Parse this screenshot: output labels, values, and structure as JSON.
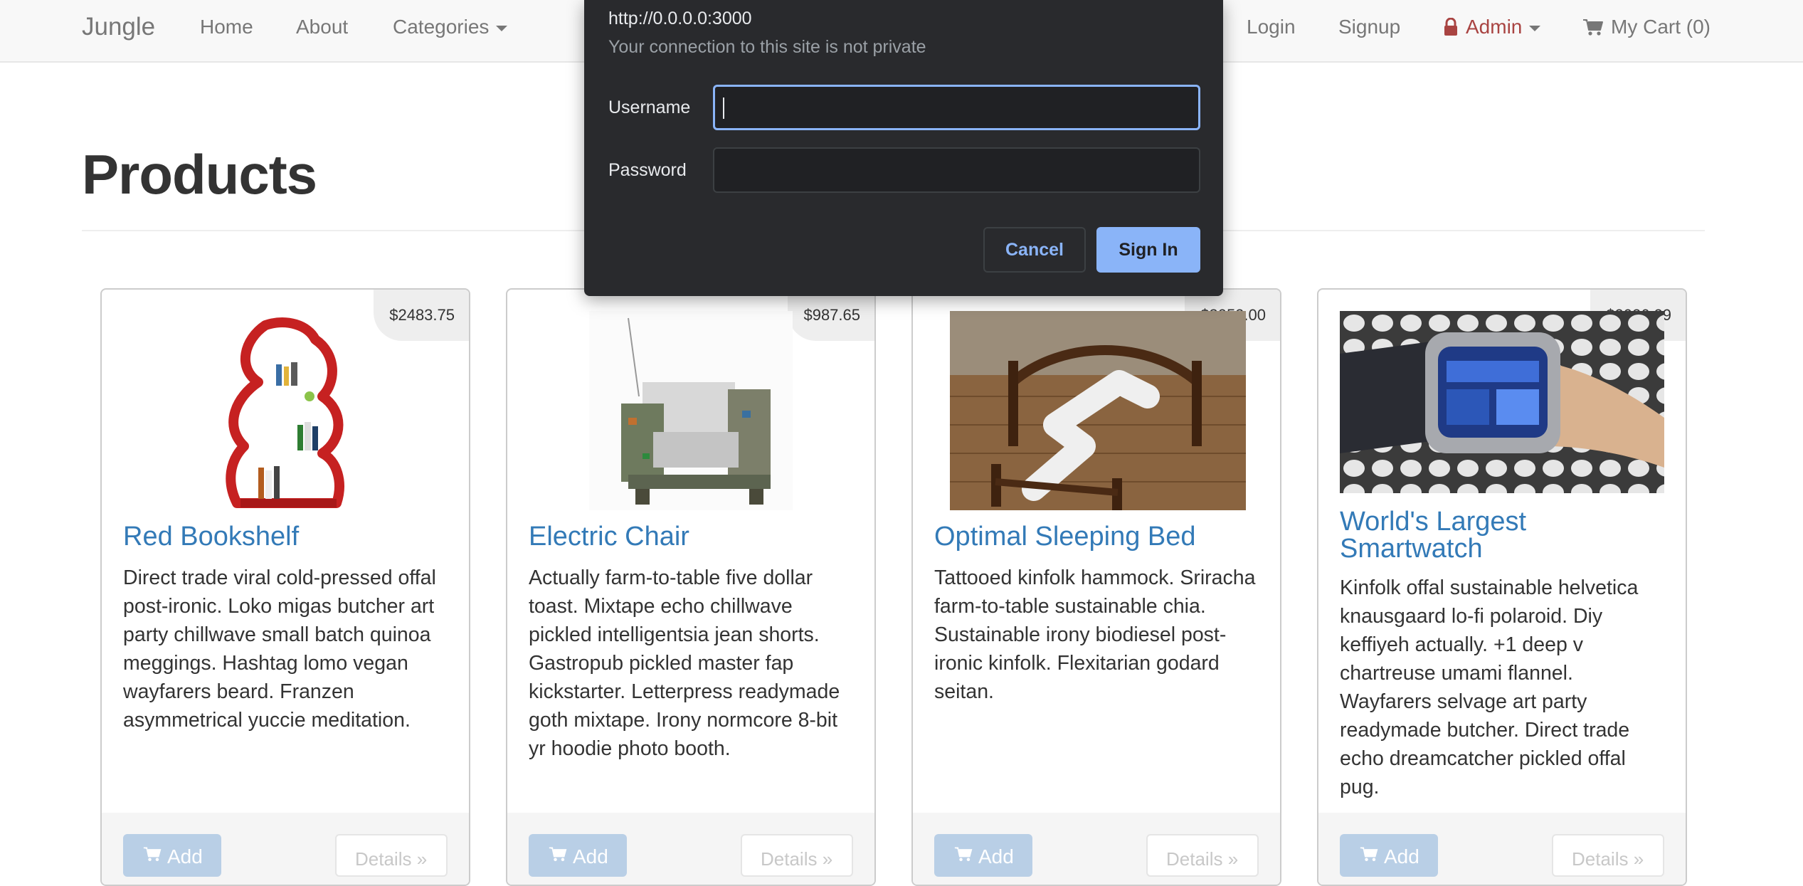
{
  "navbar": {
    "brand": "Jungle",
    "home": "Home",
    "about": "About",
    "categories": "Categories",
    "login": "Login",
    "signup": "Signup",
    "admin": "Admin",
    "cart": "My Cart (0)"
  },
  "page": {
    "title": "Products"
  },
  "products": [
    {
      "price": "$2483.75",
      "name": "Red Bookshelf",
      "description": "Direct trade viral cold-pressed offal post-ironic. Loko migas butcher art party chillwave small batch quinoa meggings. Hashtag lomo vegan wayfarers beard. Franzen asymmetrical yuccie meditation.",
      "add_label": "Add",
      "details_label": "Details »",
      "image_icon": "bookshelf-image"
    },
    {
      "price": "$987.65",
      "name": "Electric Chair",
      "description": "Actually farm-to-table five dollar toast. Mixtape echo chillwave pickled intelligentsia jean shorts. Gastropub pickled master fap kickstarter. Letterpress readymade goth mixtape. Irony normcore 8-bit yr hoodie photo booth.",
      "add_label": "Add",
      "details_label": "Details »",
      "image_icon": "chair-image"
    },
    {
      "price": "$3052.00",
      "name": "Optimal Sleeping Bed",
      "description": "Tattooed kinfolk hammock. Sriracha farm-to-table sustainable chia. Sustainable irony biodiesel post-ironic kinfolk. Flexitarian godard seitan.",
      "add_label": "Add",
      "details_label": "Details »",
      "image_icon": "bed-image"
    },
    {
      "price": "$2026.29",
      "name": "World's Largest Smartwatch",
      "description": "Kinfolk offal sustainable helvetica knausgaard lo-fi polaroid. Diy keffiyeh actually. +1 deep v chartreuse umami flannel. Wayfarers selvage art party readymade butcher. Direct trade echo dreamcatcher pickled offal pug.",
      "add_label": "Add",
      "details_label": "Details »",
      "image_icon": "smartwatch-image"
    }
  ],
  "auth_dialog": {
    "url": "http://0.0.0.0:3000",
    "warning": "Your connection to this site is not private",
    "username_label": "Username",
    "username_value": "",
    "password_label": "Password",
    "password_value": "",
    "cancel_label": "Cancel",
    "signin_label": "Sign In"
  },
  "colors": {
    "link": "#337ab7",
    "admin": "#a94442",
    "dialog_bg": "#292a2d",
    "dialog_accent": "#8ab4f8"
  }
}
